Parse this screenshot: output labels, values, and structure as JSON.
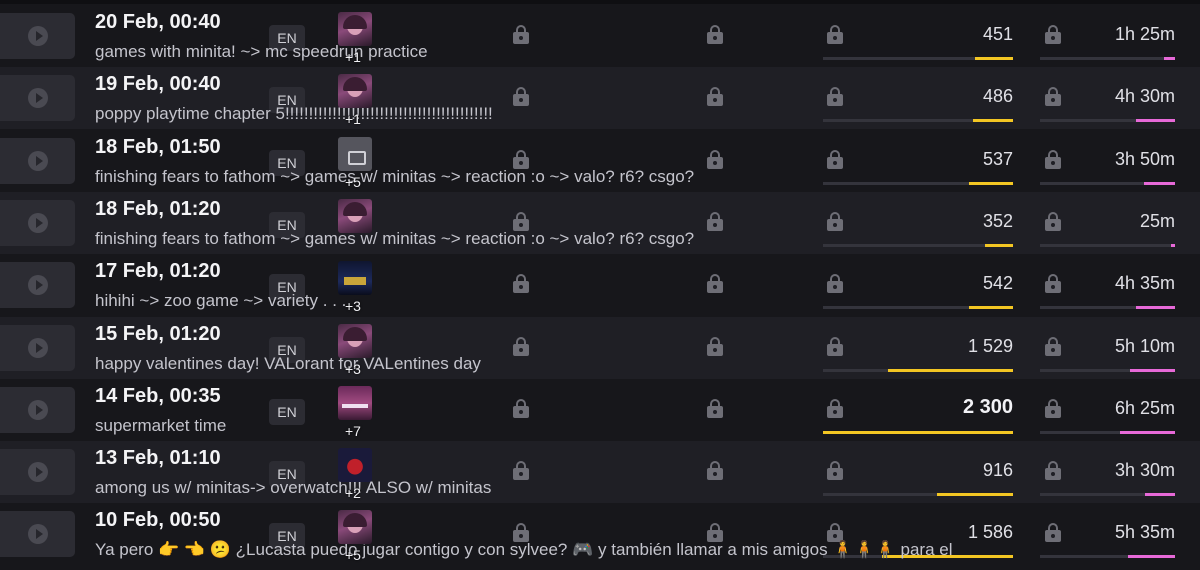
{
  "colors": {
    "viewer_bar": "#f3c623",
    "duration_bar": "#e769d8"
  },
  "streams": [
    {
      "date": "20 Feb, 00:40",
      "title": "games with minita! ~> mc speedrun practice",
      "lang": "EN",
      "thumb": "avatar",
      "more_games": "+1",
      "viewers": "451",
      "viewers_frac": 0.2,
      "duration": "1h 25m",
      "duration_frac": 0.08,
      "bold": false
    },
    {
      "date": "19 Feb, 00:40",
      "title": "poppy playtime chapter 5!!!!!!!!!!!!!!!!!!!!!!!!!!!!!!!!!!!!!!!!!!!!",
      "lang": "EN",
      "thumb": "avatar",
      "more_games": "+1",
      "viewers": "486",
      "viewers_frac": 0.21,
      "duration": "4h 30m",
      "duration_frac": 0.29,
      "bold": false
    },
    {
      "date": "18 Feb, 01:50",
      "title": "finishing fears to fathom ~> games w/ minitas ~> reaction :o ~> valo? r6? csgo?",
      "lang": "EN",
      "thumb": "generic",
      "more_games": "+5",
      "viewers": "537",
      "viewers_frac": 0.23,
      "duration": "3h 50m",
      "duration_frac": 0.23,
      "bold": false
    },
    {
      "date": "18 Feb, 01:20",
      "title": "finishing fears to fathom ~> games w/ minitas ~> reaction :o ~> valo? r6? csgo?",
      "lang": "EN",
      "thumb": "avatar",
      "more_games": "",
      "viewers": "352",
      "viewers_frac": 0.15,
      "duration": "25m",
      "duration_frac": 0.03,
      "bold": false
    },
    {
      "date": "17 Feb, 01:20",
      "title": "hihihi ~> zoo game ~> variety . . .",
      "lang": "EN",
      "thumb": "zoo",
      "more_games": "+3",
      "viewers": "542",
      "viewers_frac": 0.23,
      "duration": "4h 35m",
      "duration_frac": 0.29,
      "bold": false
    },
    {
      "date": "15 Feb, 01:20",
      "title": "happy valentines day! VALorant for VALentines day",
      "lang": "EN",
      "thumb": "avatar",
      "more_games": "+3",
      "viewers": "1 529",
      "viewers_frac": 0.66,
      "duration": "5h 10m",
      "duration_frac": 0.33,
      "bold": false
    },
    {
      "date": "14 Feb, 00:35",
      "title": "supermarket time",
      "lang": "EN",
      "thumb": "market",
      "more_games": "+7",
      "viewers": "2 300",
      "viewers_frac": 1.0,
      "duration": "6h 25m",
      "duration_frac": 0.41,
      "bold": true
    },
    {
      "date": "13 Feb, 01:10",
      "title": "among us w/ minitas-> overwatch!!! ALSO w/ minitas",
      "lang": "EN",
      "thumb": "amongus",
      "more_games": "+2",
      "viewers": "916",
      "viewers_frac": 0.4,
      "duration": "3h 30m",
      "duration_frac": 0.22,
      "bold": false
    },
    {
      "date": "10 Feb, 00:50",
      "title": "Ya pero 👉 👈 😕 ¿Lucasta puedo jugar contigo y con sylvee? 🎮 y también llamar a mis amigos 🧍🧍🧍 para el",
      "lang": "EN",
      "thumb": "avatar",
      "more_games": "+5",
      "viewers": "1 586",
      "viewers_frac": 0.69,
      "duration": "5h 35m",
      "duration_frac": 0.35,
      "bold": false
    }
  ]
}
